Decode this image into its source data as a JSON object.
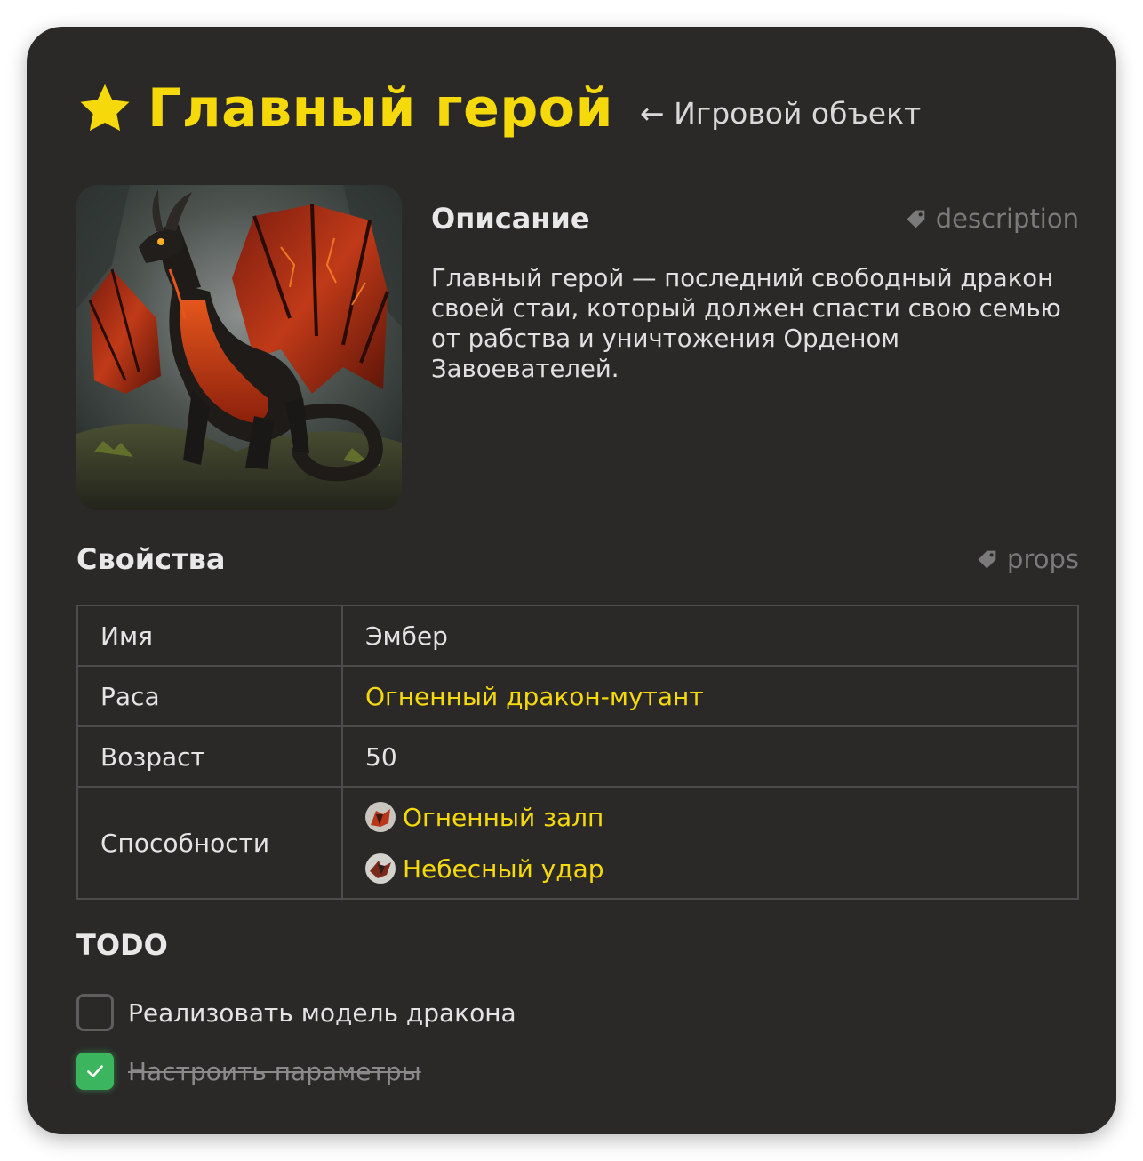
{
  "header": {
    "icon": "star-icon",
    "title": "Главный герой",
    "parent_link": "← Игровой объект",
    "accent_color": "#f5d90a"
  },
  "description": {
    "heading": "Описание",
    "tag": "description",
    "text": "Главный герой — последний свободный дракон своей стаи, который должен спасти свою семью от рабства и уничтожения Орденом Завоевателей."
  },
  "props": {
    "heading": "Свойства",
    "tag": "props",
    "rows": [
      {
        "key": "Имя",
        "value": "Эмбер"
      },
      {
        "key": "Раса",
        "value": "Огненный дракон-мутант"
      },
      {
        "key": "Возраст",
        "value": "50"
      },
      {
        "key": "Способности",
        "abilities": [
          "Огненный залп",
          "Небесный удар"
        ]
      }
    ]
  },
  "todo": {
    "heading": "TODO",
    "items": [
      {
        "label": "Реализовать модель дракона",
        "checked": false
      },
      {
        "label": "Настроить параметры",
        "checked": true
      }
    ],
    "checked_color": "#3cb65e"
  }
}
